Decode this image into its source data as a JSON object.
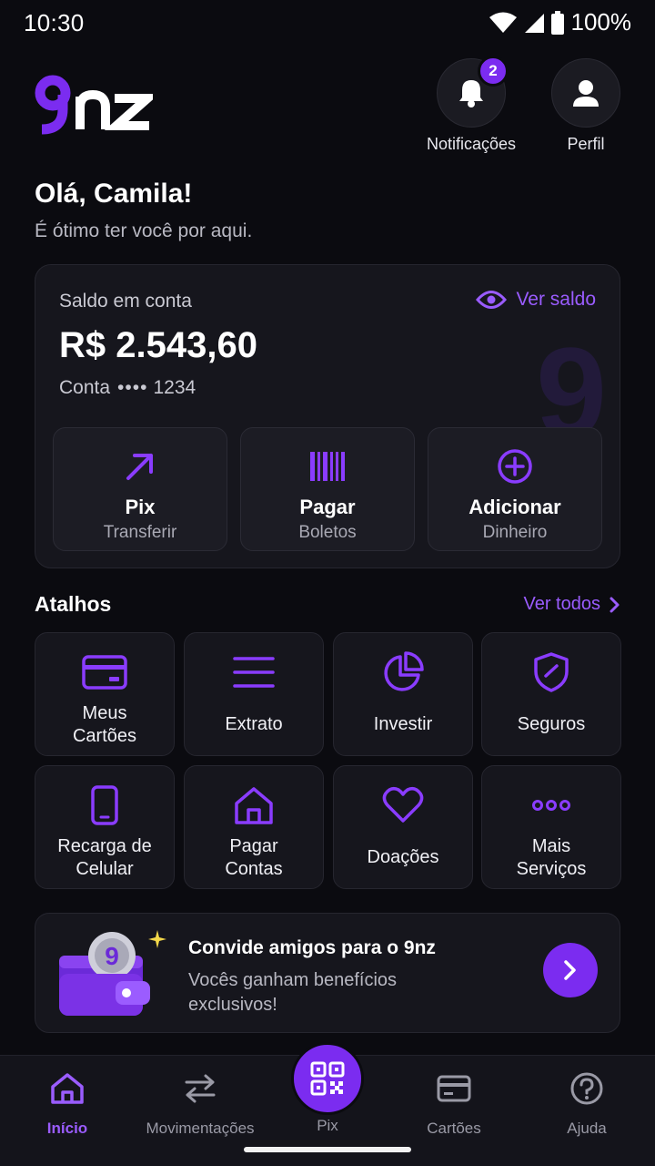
{
  "status": {
    "time": "10:30",
    "battery": "100%"
  },
  "brand": {
    "name": "9nz",
    "accent": "#7b2cf0"
  },
  "header": {
    "notifications": {
      "label": "Notificações",
      "badge": "2"
    },
    "profile": {
      "label": "Perfil"
    }
  },
  "greeting": {
    "title": "Olá, Camila!",
    "subtitle": "É ótimo ter você por aqui."
  },
  "balance": {
    "label": "Saldo em conta",
    "toggle_label": "Ver saldo",
    "value": "R$ 2.543,60",
    "account_label": "Conta",
    "account_mask": "••••",
    "account_last": "1234",
    "watermark": "9"
  },
  "actions": [
    {
      "title": "Pix",
      "subtitle": "Transferir",
      "icon": "arrow-up-right-icon"
    },
    {
      "title": "Pagar",
      "subtitle": "Boletos",
      "icon": "barcode-icon"
    },
    {
      "title": "Adicionar",
      "subtitle": "Dinheiro",
      "icon": "plus-circle-icon"
    }
  ],
  "shortcuts": {
    "title": "Atalhos",
    "see_all": "Ver todos",
    "items": [
      {
        "label": "Meus\nCartões",
        "icon": "card-icon"
      },
      {
        "label": "Extrato",
        "icon": "list-icon"
      },
      {
        "label": "Investir",
        "icon": "pie-chart-icon"
      },
      {
        "label": "Seguros",
        "icon": "shield-icon"
      },
      {
        "label": "Recarga de\nCelular",
        "icon": "phone-icon"
      },
      {
        "label": "Pagar\nContas",
        "icon": "house-icon"
      },
      {
        "label": "Doações",
        "icon": "heart-icon"
      },
      {
        "label": "Mais\nServiços",
        "icon": "more-icon"
      }
    ]
  },
  "invite": {
    "title": "Convide amigos para o 9nz",
    "text": "Vocês ganham benefícios exclusivos!"
  },
  "nav": {
    "items": [
      {
        "label": "Início",
        "icon": "home-icon",
        "active": true
      },
      {
        "label": "Movimentações",
        "icon": "transfer-icon",
        "active": false
      },
      {
        "label": "Pix",
        "icon": "qr-code-icon",
        "active": false
      },
      {
        "label": "Cartões",
        "icon": "card-icon",
        "active": false
      },
      {
        "label": "Ajuda",
        "icon": "help-icon",
        "active": false
      }
    ]
  }
}
